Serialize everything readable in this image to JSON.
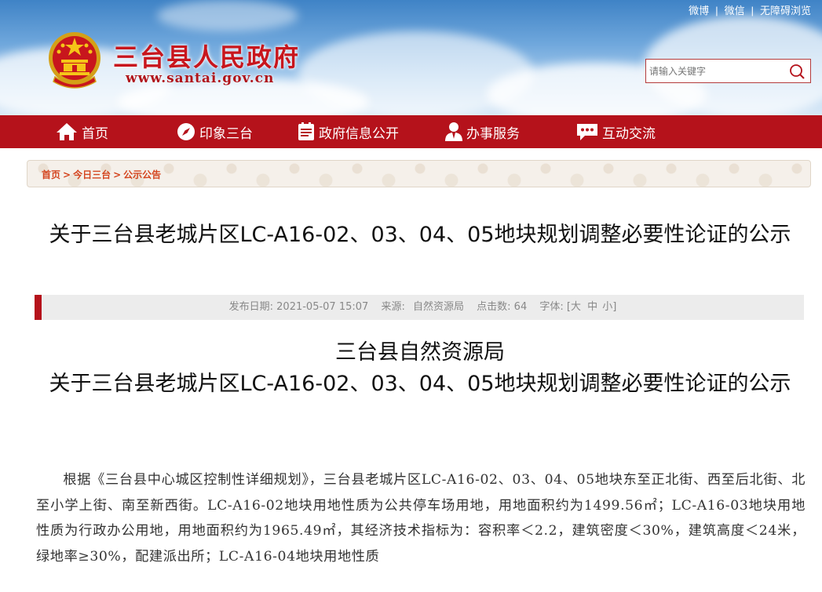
{
  "header": {
    "toplinks": [
      "微博",
      "微信",
      "无障碍浏览"
    ],
    "site_title": "三台县人民政府",
    "site_url": "www.santai.gov.cn",
    "search": {
      "placeholder": "请输入关键字",
      "icon": "search-icon"
    }
  },
  "nav": {
    "items": [
      {
        "label": "首页",
        "icon": "home-icon"
      },
      {
        "label": "印象三台",
        "icon": "compass-icon"
      },
      {
        "label": "政府信息公开",
        "icon": "document-icon"
      },
      {
        "label": "办事服务",
        "icon": "person-icon"
      },
      {
        "label": "互动交流",
        "icon": "chat-icon"
      }
    ]
  },
  "breadcrumb": [
    "首页",
    "今日三台",
    "公示公告"
  ],
  "article": {
    "title": "关于三台县老城片区LC-A16-02、03、04、05地块规划调整必要性论证的公示",
    "meta": {
      "date_label": "发布日期:",
      "date": "2021-05-07 15:07",
      "source_label": "来源:",
      "source": "自然资源局",
      "clicks_label": "点击数:",
      "clicks": "64",
      "fontsize_label": "字体:",
      "fontsize_open": "[",
      "fontsize_large": "大",
      "fontsize_medium": "中",
      "fontsize_small": "小",
      "fontsize_close": "]"
    },
    "body_heading_line1": "三台县自然资源局",
    "body_heading_line2": "关于三台县老城片区LC-A16-02、03、04、05地块规划调整必要性论证的公示",
    "paragraph": "根据《三台县中心城区控制性详细规划》，三台县老城片区LC-A16-02、03、04、05地块东至正北街、西至后北街、北至小学上街、南至新西街。LC-A16-02地块用地性质为公共停车场用地，用地面积约为1499.56㎡；LC-A16-03地块用地性质为行政办公用地，用地面积约为1965.49㎡，其经济技术指标为：容积率＜2.2，建筑密度＜30%，建筑高度＜24米，绿地率≥30%，配建派出所；LC-A16-04地块用地性质"
  },
  "colors": {
    "brand_red": "#b5121b",
    "title_red": "#c8161d",
    "crumb_text": "#d4451f"
  }
}
